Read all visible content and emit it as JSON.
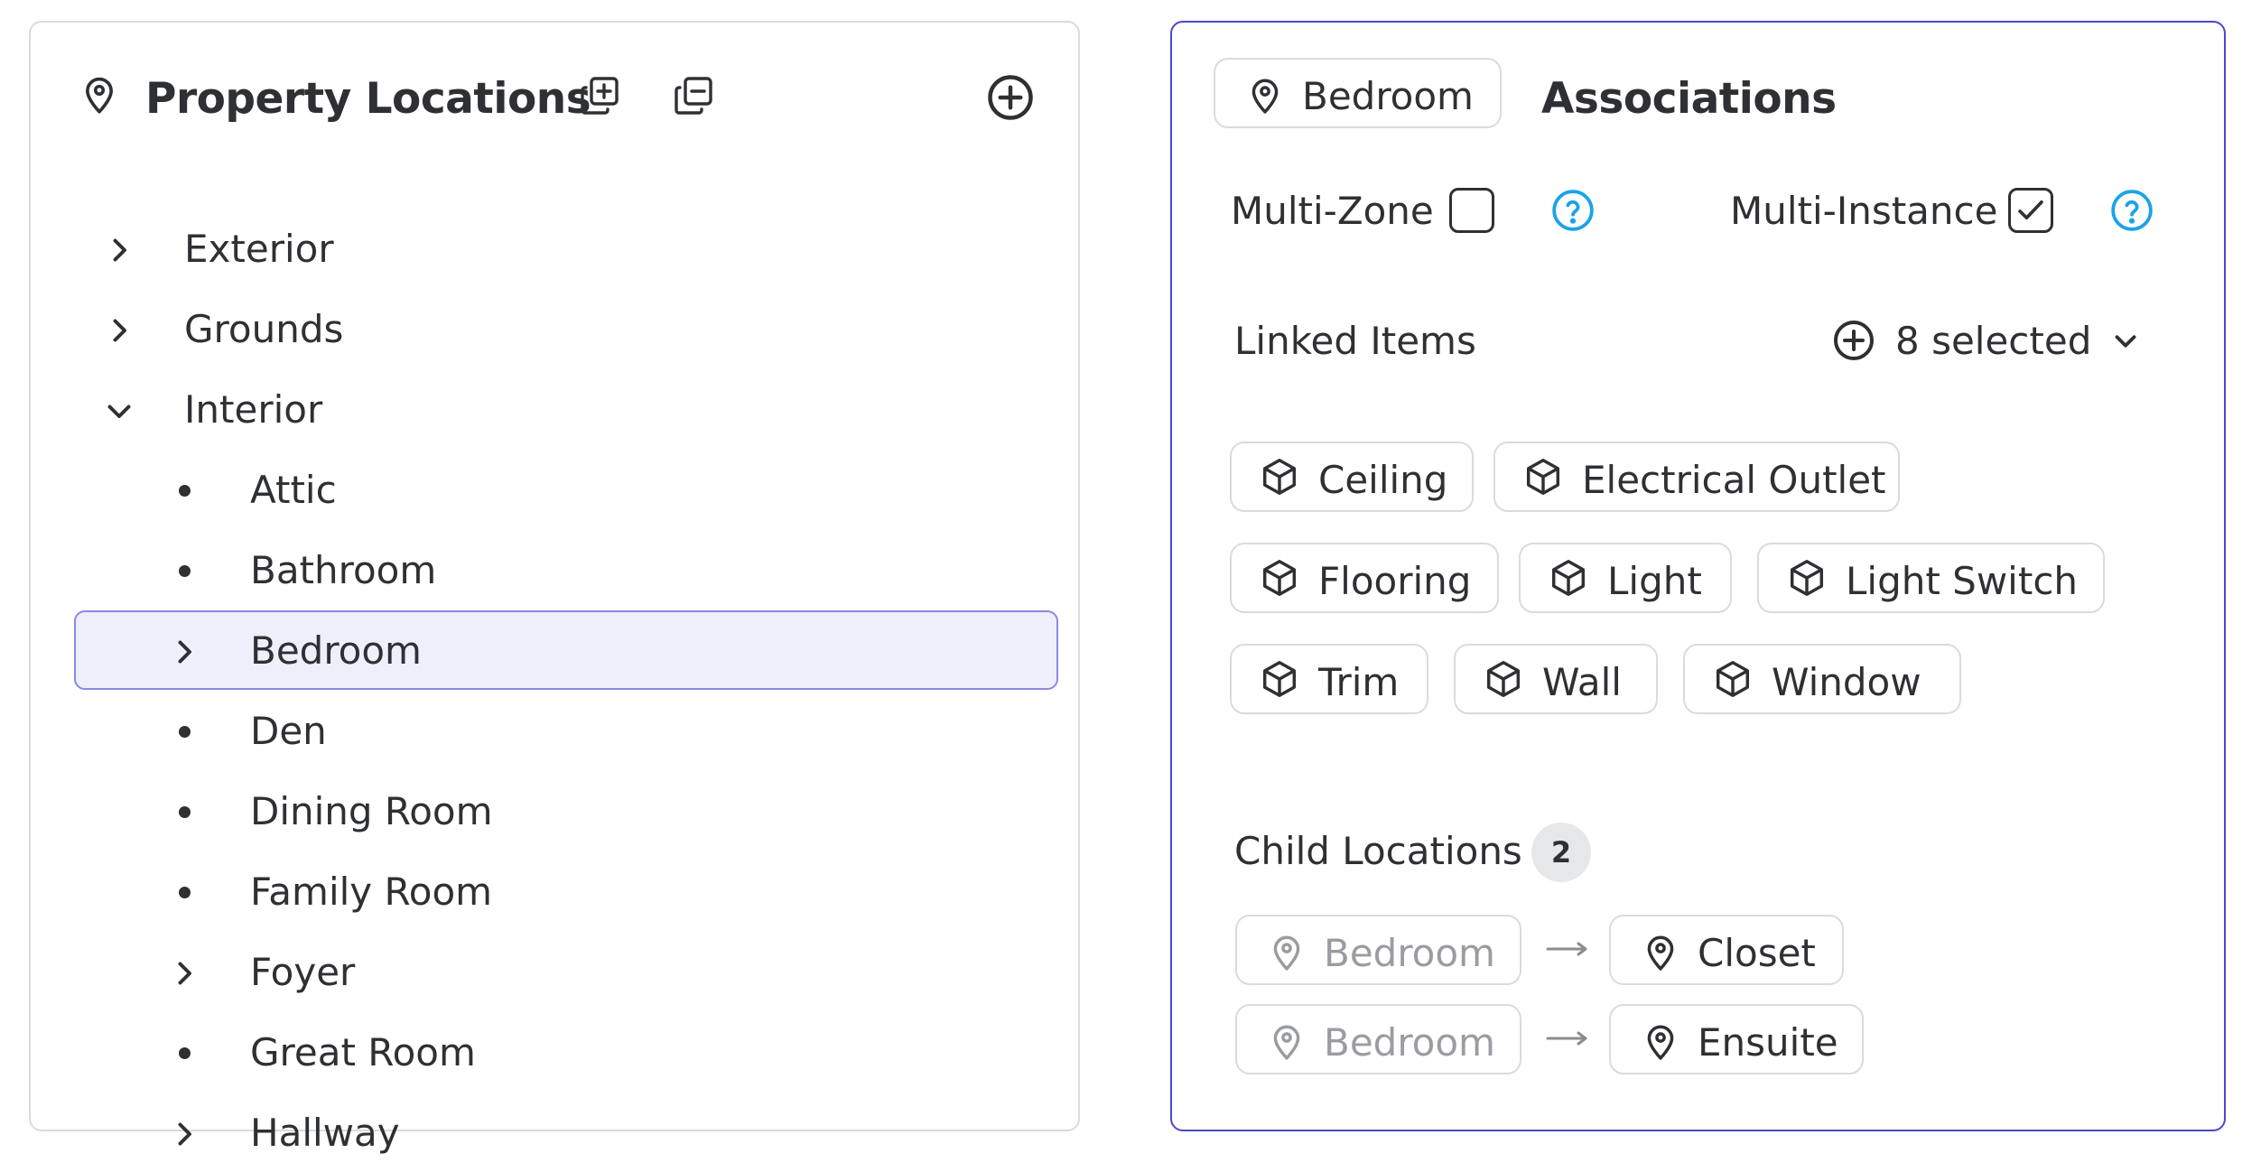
{
  "locations_panel": {
    "title": "Property Locations",
    "icons": {
      "title": "map-pin-icon",
      "expand_all": "expand-all-icon",
      "collapse_all": "collapse-all-icon",
      "add": "add-circle-icon"
    },
    "tree": [
      {
        "label": "Exterior",
        "level": 0,
        "marker": "chevron-right"
      },
      {
        "label": "Grounds",
        "level": 0,
        "marker": "chevron-right"
      },
      {
        "label": "Interior",
        "level": 0,
        "marker": "chevron-down"
      },
      {
        "label": "Attic",
        "level": 1,
        "marker": "bullet"
      },
      {
        "label": "Bathroom",
        "level": 1,
        "marker": "bullet"
      },
      {
        "label": "Bedroom",
        "level": 1,
        "marker": "chevron-right",
        "selected": true
      },
      {
        "label": "Den",
        "level": 1,
        "marker": "bullet"
      },
      {
        "label": "Dining Room",
        "level": 1,
        "marker": "bullet"
      },
      {
        "label": "Family Room",
        "level": 1,
        "marker": "bullet"
      },
      {
        "label": "Foyer",
        "level": 1,
        "marker": "chevron-right"
      },
      {
        "label": "Great Room",
        "level": 1,
        "marker": "bullet"
      },
      {
        "label": "Hallway",
        "level": 1,
        "marker": "chevron-right"
      }
    ]
  },
  "associations_panel": {
    "location_chip": "Bedroom",
    "title": "Associations",
    "multi_zone": {
      "label": "Multi-Zone",
      "checked": false
    },
    "multi_instance": {
      "label": "Multi-Instance",
      "checked": true
    },
    "linked_items": {
      "label": "Linked Items",
      "selected_text": "8 selected",
      "items": [
        "Ceiling",
        "Electrical Outlet",
        "Flooring",
        "Light",
        "Light Switch",
        "Trim",
        "Wall",
        "Window"
      ]
    },
    "child_locations": {
      "label": "Child Locations",
      "count": "2",
      "pairs": [
        {
          "parent": "Bedroom",
          "child": "Closet"
        },
        {
          "parent": "Bedroom",
          "child": "Ensuite"
        }
      ]
    }
  },
  "colors": {
    "accent": "#4a48c8",
    "selected_bg": "#eeeffb",
    "selected_border": "#8a89e2",
    "help": "#1aa3e8",
    "text": "#2e3033",
    "muted": "#9a9ca1",
    "border": "#d9dbe0"
  }
}
